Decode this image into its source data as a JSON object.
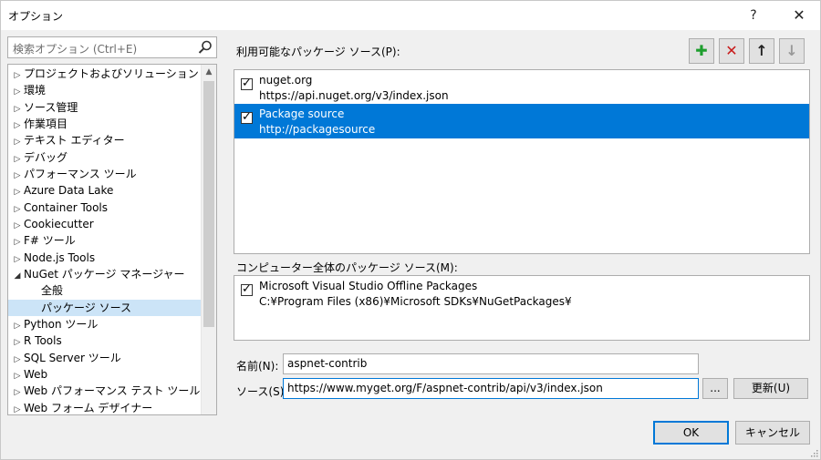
{
  "window": {
    "title": "オプション",
    "help": "?",
    "close": "✕"
  },
  "search": {
    "placeholder": "検索オプション (Ctrl+E)"
  },
  "tree": {
    "items": [
      {
        "label": "プロジェクトおよびソリューション",
        "arrow": "▷"
      },
      {
        "label": "環境",
        "arrow": "▷"
      },
      {
        "label": "ソース管理",
        "arrow": "▷"
      },
      {
        "label": "作業項目",
        "arrow": "▷"
      },
      {
        "label": "テキスト エディター",
        "arrow": "▷"
      },
      {
        "label": "デバッグ",
        "arrow": "▷"
      },
      {
        "label": "パフォーマンス ツール",
        "arrow": "▷"
      },
      {
        "label": "Azure Data Lake",
        "arrow": "▷"
      },
      {
        "label": "Container Tools",
        "arrow": "▷"
      },
      {
        "label": "Cookiecutter",
        "arrow": "▷"
      },
      {
        "label": "F# ツール",
        "arrow": "▷"
      },
      {
        "label": "Node.js Tools",
        "arrow": "▷"
      },
      {
        "label": "NuGet パッケージ マネージャー",
        "arrow": "◢"
      },
      {
        "label": "全般",
        "arrow": ""
      },
      {
        "label": "パッケージ ソース",
        "arrow": ""
      },
      {
        "label": "Python ツール",
        "arrow": "▷"
      },
      {
        "label": "R Tools",
        "arrow": "▷"
      },
      {
        "label": "SQL Server ツール",
        "arrow": "▷"
      },
      {
        "label": "Web",
        "arrow": "▷"
      },
      {
        "label": "Web パフォーマンス テスト ツール",
        "arrow": "▷"
      },
      {
        "label": "Web フォーム デザイナー",
        "arrow": "▷"
      }
    ]
  },
  "available_sources": {
    "label": "利用可能なパッケージ ソース(P):",
    "items": [
      {
        "name": "nuget.org",
        "url": "https://api.nuget.org/v3/index.json",
        "checked": "✓"
      },
      {
        "name": "Package source",
        "url": "http://packagesource",
        "checked": "✓"
      }
    ]
  },
  "toolbar": {
    "add": "✚",
    "remove": "✕",
    "up": "↑",
    "down": "↓"
  },
  "machine_sources": {
    "label": "コンピューター全体のパッケージ ソース(M):",
    "items": [
      {
        "name": "Microsoft Visual Studio Offline Packages",
        "url": "C:¥Program Files (x86)¥Microsoft SDKs¥NuGetPackages¥",
        "checked": "✓"
      }
    ]
  },
  "form": {
    "name_label": "名前(N):",
    "name_value": "aspnet-contrib",
    "source_label": "ソース(S):",
    "source_value": "https://www.myget.org/F/aspnet-contrib/api/v3/index.json",
    "browse": "...",
    "update": "更新(U)"
  },
  "footer": {
    "ok": "OK",
    "cancel": "キャンセル"
  },
  "colors": {
    "selection": "#0078d7",
    "add_green": "#1e9e2e",
    "remove_red": "#c81a1a"
  }
}
